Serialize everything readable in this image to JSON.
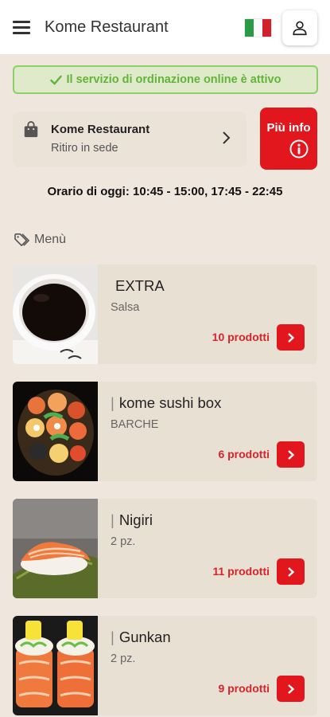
{
  "header": {
    "title": "Kome Restaurant",
    "flag_icon": "italy-flag-icon",
    "user_icon": "user-icon"
  },
  "status_banner": {
    "text": "Il servizio di ordinazione online è attivo",
    "color": "#63b33a"
  },
  "restaurant": {
    "name": "Kome Restaurant",
    "subtitle": "Ritiro in sede"
  },
  "info_button": {
    "label": "Più info"
  },
  "hours": "Orario di oggi: 10:45 - 15:00, 17:45 - 22:45",
  "menu": {
    "heading": "Menù",
    "categories": [
      {
        "name": "EXTRA",
        "prefix": "",
        "desc": "Salsa",
        "count": "10 prodotti"
      },
      {
        "name": "kome sushi box",
        "prefix": "|",
        "desc": "BARCHE",
        "count": "6 prodotti"
      },
      {
        "name": "Nigiri",
        "prefix": "|",
        "desc": "2 pz.",
        "count": "11 prodotti"
      },
      {
        "name": "Gunkan",
        "prefix": "|",
        "desc": "2 pz.",
        "count": "9 prodotti"
      }
    ]
  },
  "colors": {
    "accent": "#e2161d",
    "background": "#efe7dd"
  }
}
